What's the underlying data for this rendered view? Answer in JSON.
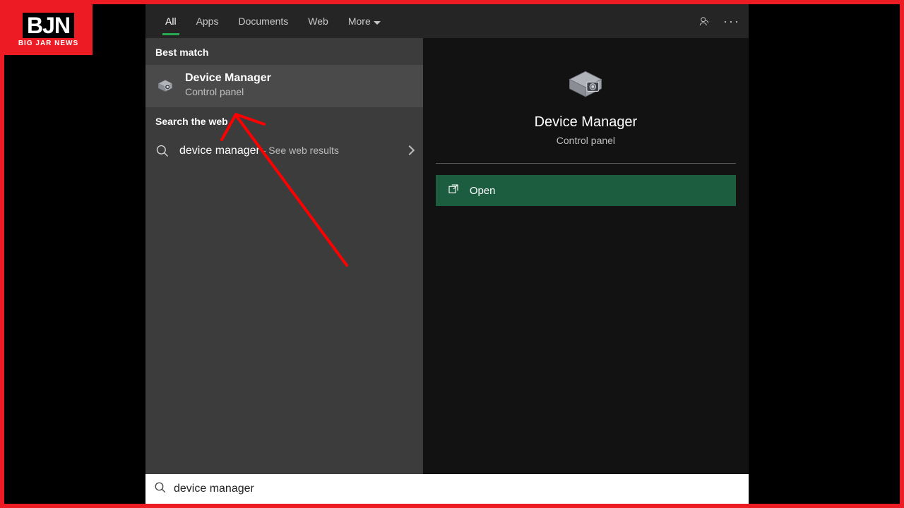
{
  "logo": {
    "main": "BJN",
    "sub": "BIG JAR NEWS"
  },
  "tabs": {
    "all": "All",
    "apps": "Apps",
    "documents": "Documents",
    "web": "Web",
    "more": "More"
  },
  "sections": {
    "best_match": "Best match",
    "search_web": "Search the web"
  },
  "best_match": {
    "title": "Device Manager",
    "subtitle": "Control panel"
  },
  "web_result": {
    "term": "device manager",
    "hint": " - See web results"
  },
  "preview": {
    "title": "Device Manager",
    "subtitle": "Control panel"
  },
  "actions": {
    "open": "Open"
  },
  "search": {
    "value": "device manager"
  }
}
